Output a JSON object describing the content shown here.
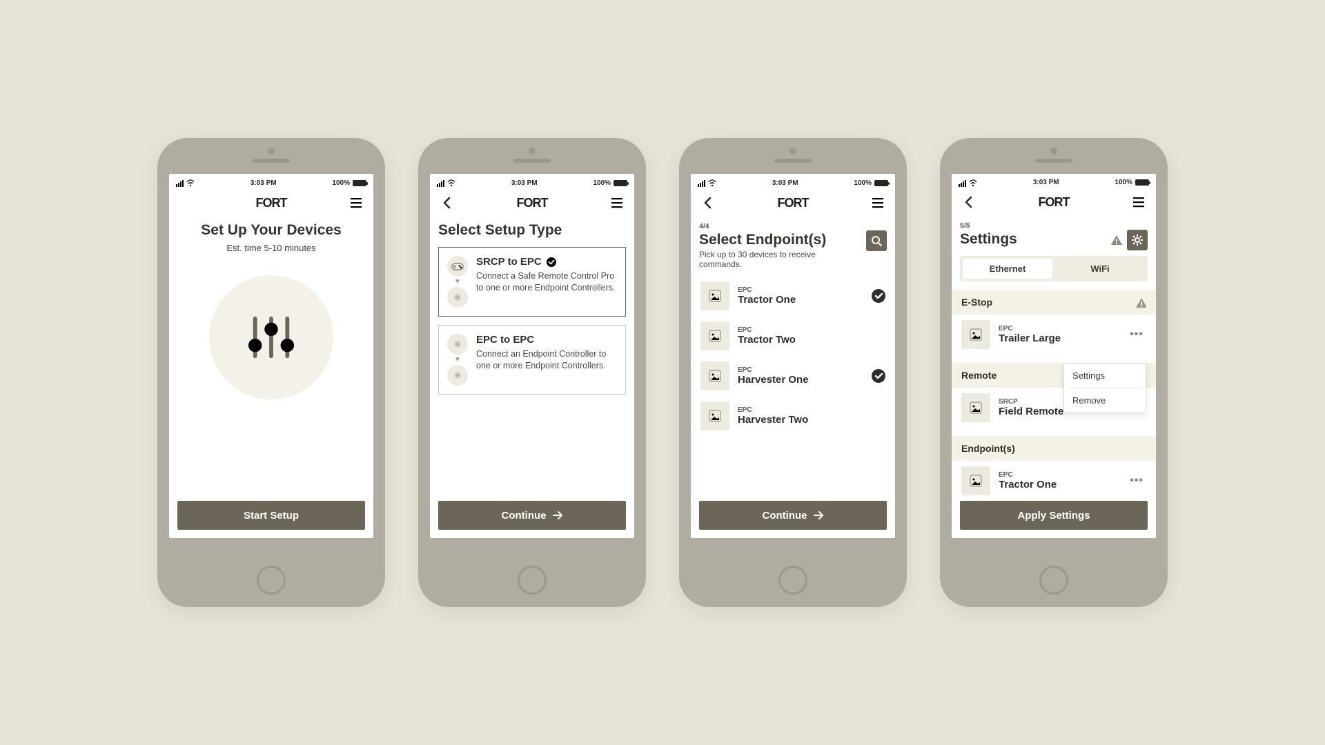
{
  "status": {
    "time": "3:03 PM",
    "battery": "100%"
  },
  "brand": "FORT",
  "screen1": {
    "title": "Set Up Your Devices",
    "subtitle": "Est. time 5-10 minutes",
    "cta": "Start Setup"
  },
  "screen2": {
    "title": "Select Setup Type",
    "option1": {
      "title": "SRCP to EPC",
      "desc": "Connect a Safe Remote Control Pro to one or more Endpoint Controllers."
    },
    "option2": {
      "title": "EPC to EPC",
      "desc": "Connect an Endpoint Controller to one or more Endpoint Controllers."
    },
    "cta": "Continue"
  },
  "screen3": {
    "step": "4/4",
    "title": "Select Endpoint(s)",
    "helper": "Pick up to 30 devices to receive commands.",
    "items": [
      {
        "kicker": "EPC",
        "title": "Tractor One",
        "selected": true
      },
      {
        "kicker": "EPC",
        "title": "Tractor Two",
        "selected": false
      },
      {
        "kicker": "EPC",
        "title": "Harvester One",
        "selected": true
      },
      {
        "kicker": "EPC",
        "title": "Harvester Two",
        "selected": false
      }
    ],
    "cta": "Continue"
  },
  "screen4": {
    "step": "5/5",
    "title": "Settings",
    "tabs": {
      "a": "Ethernet",
      "b": "WiFi"
    },
    "sections": {
      "estop": "E-Stop",
      "remote": "Remote",
      "endpoints": "Endpoint(s)"
    },
    "estop_item": {
      "kicker": "EPC",
      "title": "Trailer Large"
    },
    "remote_item": {
      "kicker": "SRCP",
      "title": "Field Remote"
    },
    "endpoint_item": {
      "kicker": "EPC",
      "title": "Tractor One"
    },
    "popover": {
      "settings": "Settings",
      "remove": "Remove"
    },
    "cta": "Apply Settings"
  }
}
